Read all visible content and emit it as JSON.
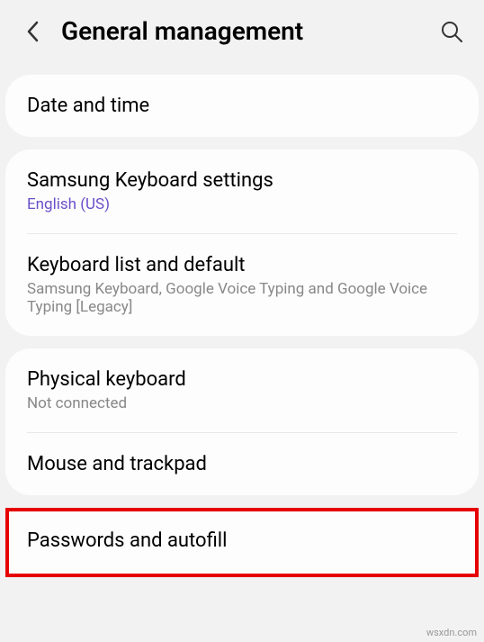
{
  "header": {
    "title": "General management"
  },
  "groups": [
    {
      "items": [
        {
          "title": "Date and time"
        }
      ]
    },
    {
      "items": [
        {
          "title": "Samsung Keyboard settings",
          "sub": "English (US)",
          "subStyle": "link"
        },
        {
          "title": "Keyboard list and default",
          "sub": "Samsung Keyboard, Google Voice Typing and Google Voice Typing [Legacy]"
        }
      ]
    },
    {
      "items": [
        {
          "title": "Physical keyboard",
          "sub": "Not connected"
        },
        {
          "title": "Mouse and trackpad"
        }
      ]
    }
  ],
  "highlighted": {
    "title": "Passwords and autofill"
  },
  "watermark": "wsxdn.com"
}
